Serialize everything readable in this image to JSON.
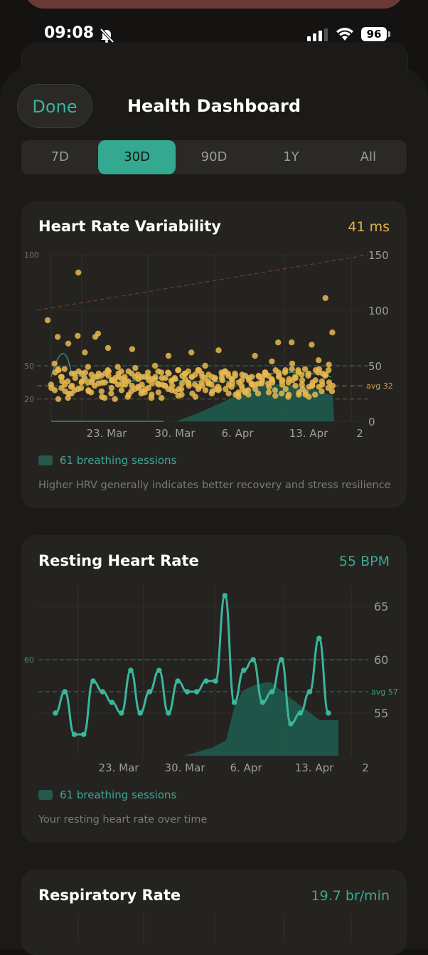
{
  "status": {
    "time": "09:08",
    "battery": "96"
  },
  "header": {
    "done_label": "Done",
    "title": "Health Dashboard"
  },
  "range_tabs": [
    {
      "label": "7D",
      "active": false
    },
    {
      "label": "30D",
      "active": true
    },
    {
      "label": "90D",
      "active": false
    },
    {
      "label": "1Y",
      "active": false
    },
    {
      "label": "All",
      "active": false
    }
  ],
  "hrv": {
    "title": "Heart Rate Variability",
    "value": "41 ms",
    "value_color": "#e1b34a",
    "legend": "61 breathing sessions",
    "description": "Higher HRV generally indicates better recovery and stress resilience",
    "x_ticks": [
      "23. Mar",
      "30. Mar",
      "6. Apr",
      "13. Apr",
      "2"
    ],
    "y_right_ticks": [
      "150",
      "100",
      "50",
      "0"
    ],
    "y_left_labels": [
      "100",
      "50",
      "20"
    ],
    "avg_label": "avg 32"
  },
  "rhr": {
    "title": "Resting Heart Rate",
    "value": "55 BPM",
    "value_color": "#3ba994",
    "legend": "61 breathing sessions",
    "description": "Your resting heart rate over time",
    "x_ticks": [
      "23. Mar",
      "30. Mar",
      "6. Apr",
      "13. Apr",
      "2"
    ],
    "y_right_ticks": [
      "65",
      "60",
      "55"
    ],
    "y_left_labels": [
      "60"
    ],
    "avg_label": "avg 57"
  },
  "resp": {
    "title": "Respiratory Rate",
    "value": "19.7 br/min",
    "value_color": "#3ba994"
  },
  "chart_data": [
    {
      "type": "scatter",
      "title": "Heart Rate Variability",
      "unit": "ms",
      "ylim": [
        0,
        150
      ],
      "reference_lines": [
        100,
        50,
        20
      ],
      "average": 32,
      "x_ticks": [
        "23. Mar",
        "30. Mar",
        "6. Apr",
        "13. Apr",
        "2"
      ],
      "series": [
        {
          "name": "HRV",
          "values": [
            91,
            30,
            44,
            33,
            28,
            46,
            52,
            20,
            36,
            47,
            40,
            76,
            30,
            27,
            40,
            33,
            25,
            47,
            70,
            32,
            21,
            43,
            36,
            25,
            39,
            31,
            43,
            45,
            28,
            134,
            36,
            29,
            43,
            77,
            35,
            44,
            30,
            62,
            27,
            39,
            28,
            37,
            49,
            35,
            35,
            42,
            76,
            26,
            40,
            43,
            32,
            34,
            35,
            79,
            22,
            40,
            27,
            43,
            41,
            35,
            45,
            21,
            41,
            37,
            66,
            37,
            46,
            30,
            39,
            25,
            20,
            40,
            36,
            43,
            33,
            33,
            38,
            49,
            28,
            33,
            45,
            37,
            24,
            40,
            45,
            65,
            36,
            32,
            22,
            43,
            48,
            27,
            40,
            30,
            29,
            38,
            27,
            31,
            33,
            42,
            40,
            29,
            25,
            40,
            37,
            26,
            30,
            38,
            40,
            34,
            44,
            24,
            40,
            21,
            50,
            33,
            38,
            26,
            33,
            45,
            39,
            34,
            21,
            39,
            44,
            32,
            43,
            32,
            59,
            32,
            29,
            37,
            44,
            28,
            27,
            36,
            38,
            29,
            39,
            46,
            41,
            23,
            34,
            46,
            24,
            43,
            29,
            38,
            32,
            43,
            34,
            25,
            45,
            40,
            35,
            40,
            22,
            62,
            42,
            46,
            33,
            31,
            40,
            29,
            32,
            46,
            35,
            28,
            43,
            50,
            34,
            39,
            42,
            27,
            34,
            40,
            36,
            25,
            29,
            33,
            39,
            29,
            38,
            64,
            37,
            28,
            42,
            31,
            39,
            29,
            44,
            45,
            33,
            45,
            25,
            34,
            41,
            38,
            43,
            38,
            24,
            31,
            41,
            35,
            43,
            22,
            29,
            26,
            42,
            24,
            37,
            27,
            32,
            41,
            37,
            26,
            39,
            33,
            24,
            33,
            28,
            40,
            33,
            34,
            29,
            40,
            59,
            41,
            40,
            34,
            37,
            25,
            35,
            42,
            34,
            44,
            31,
            44,
            26,
            35,
            41,
            37,
            34,
            54,
            46,
            38,
            23,
            41,
            28,
            40,
            37,
            44,
            33,
            71,
            36,
            29,
            25,
            46,
            38,
            44,
            24,
            37,
            35,
            52,
            22,
            47,
            39,
            71,
            32,
            26,
            40,
            24,
            29,
            44,
            37,
            46,
            33,
            26,
            42,
            24,
            31,
            47,
            22,
            35,
            43,
            32,
            41,
            32,
            46,
            69,
            37,
            47,
            24,
            31,
            43,
            55,
            33,
            44,
            36,
            42,
            27,
            111,
            35,
            41,
            51,
            32,
            46,
            80,
            30,
            27
          ]
        }
      ]
    },
    {
      "type": "line",
      "title": "Resting Heart Rate",
      "unit": "BPM",
      "ylim": [
        51,
        67
      ],
      "reference_lines": [
        60
      ],
      "average": 57,
      "x_ticks": [
        "23. Mar",
        "30. Mar",
        "6. Apr",
        "13. Apr",
        "2"
      ],
      "series": [
        {
          "name": "Resting HR",
          "values": [
            55,
            57,
            53,
            53,
            58,
            57,
            56,
            55,
            59,
            55,
            57,
            59,
            55,
            58,
            57,
            57,
            58,
            58,
            66,
            56,
            59,
            60,
            56,
            57,
            60,
            54,
            55,
            57,
            62,
            55
          ]
        }
      ]
    }
  ]
}
